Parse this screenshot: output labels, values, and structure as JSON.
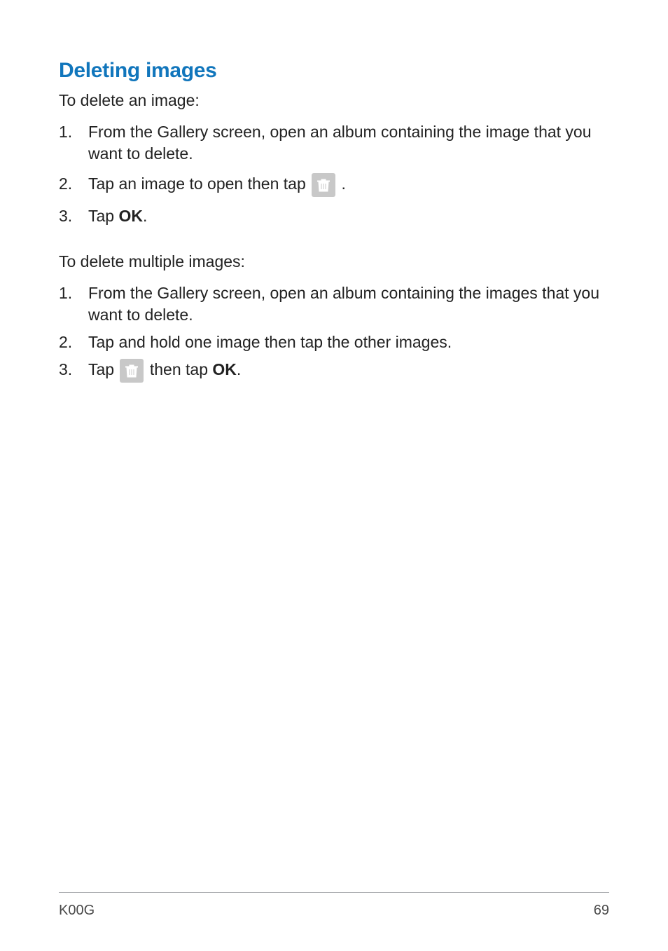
{
  "heading": "Deleting images",
  "intro1": "To delete an image:",
  "steps1": {
    "s1": "From the Gallery screen, open an album containing the image that you want to delete.",
    "s2_a": "Tap an image to open then tap ",
    "s2_b": ".",
    "s3_a": "Tap ",
    "s3_ok": "OK",
    "s3_b": "."
  },
  "intro2": "To delete multiple images:",
  "steps2": {
    "s1": "From the Gallery screen, open an album containing the images that you want to delete.",
    "s2": "Tap and hold one image then tap the other images.",
    "s3_a": "Tap ",
    "s3_b": " then tap ",
    "s3_ok": "OK",
    "s3_c": "."
  },
  "footer": {
    "model": "K00G",
    "page": "69"
  }
}
